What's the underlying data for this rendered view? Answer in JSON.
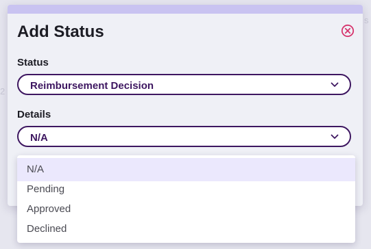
{
  "modal": {
    "title": "Add Status",
    "close_icon": "close-circle-icon"
  },
  "status_field": {
    "label": "Status",
    "value": "Reimbursement Decision"
  },
  "details_field": {
    "label": "Details",
    "value": "N/A"
  },
  "dropdown": {
    "options": [
      "N/A",
      "Pending",
      "Approved",
      "Declined"
    ],
    "highlighted": "N/A"
  },
  "colors": {
    "accent": "#3d1660",
    "close": "#d6336c",
    "topbar": "#c9c3f1",
    "option_highlight": "#ebe8fd"
  }
}
